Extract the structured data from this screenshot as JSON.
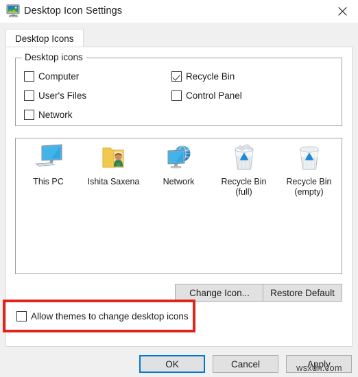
{
  "window": {
    "title": "Desktop Icon Settings",
    "icon": "desktop-monitor-icon",
    "close_label": "✕"
  },
  "tabs": [
    {
      "label": "Desktop Icons",
      "selected": true
    }
  ],
  "group": {
    "legend": "Desktop icons",
    "checkboxes": [
      {
        "label": "Computer",
        "checked": false,
        "name": "checkbox-computer"
      },
      {
        "label": "User's Files",
        "checked": false,
        "name": "checkbox-users-files"
      },
      {
        "label": "Network",
        "checked": false,
        "name": "checkbox-network"
      },
      {
        "label": "Recycle Bin",
        "checked": true,
        "name": "checkbox-recycle-bin"
      },
      {
        "label": "Control Panel",
        "checked": false,
        "name": "checkbox-control-panel"
      }
    ]
  },
  "preview": {
    "items": [
      {
        "label": "This PC",
        "icon": "this-pc-icon"
      },
      {
        "label": "Ishita Saxena",
        "icon": "user-folder-icon"
      },
      {
        "label": "Network",
        "icon": "network-icon"
      },
      {
        "label": "Recycle Bin\n(full)",
        "line1": "Recycle Bin",
        "line2": "(full)",
        "icon": "recycle-bin-full-icon"
      },
      {
        "label": "Recycle Bin\n(empty)",
        "line1": "Recycle Bin",
        "line2": "(empty)",
        "icon": "recycle-bin-empty-icon"
      }
    ]
  },
  "buttons": {
    "change_icon": "Change Icon...",
    "restore_default": "Restore Default",
    "ok": "OK",
    "cancel": "Cancel",
    "apply": "Apply"
  },
  "allow_themes": {
    "label": "Allow themes to change desktop icons",
    "checked": false
  },
  "annotation": {
    "highlight_color": "#e2231a"
  },
  "watermark": {
    "text": "wsxdn.com"
  }
}
